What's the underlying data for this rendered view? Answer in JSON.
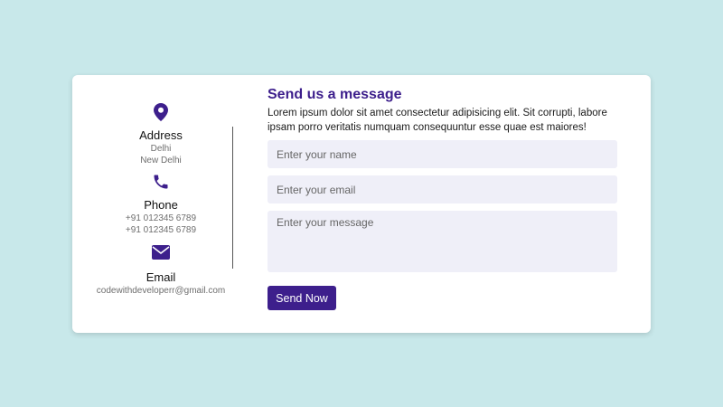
{
  "colors": {
    "background": "#c8e8ea",
    "accent": "#3d1f8c",
    "field_bg": "#efeff8"
  },
  "contact": {
    "address": {
      "icon": "map-pin-icon",
      "label": "Address",
      "lines": [
        "Delhi",
        "New Delhi"
      ]
    },
    "phone": {
      "icon": "phone-icon",
      "label": "Phone",
      "lines": [
        "+91 012345 6789",
        "+91 012345 6789"
      ]
    },
    "email": {
      "icon": "envelope-icon",
      "label": "Email",
      "lines": [
        "codewithdeveloperr@gmail.com"
      ]
    }
  },
  "form": {
    "title": "Send us a message",
    "description": "Lorem ipsum dolor sit amet consectetur adipisicing elit. Sit corrupti, labore ipsam porro veritatis numquam consequuntur esse quae est maiores!",
    "name_placeholder": "Enter your name",
    "email_placeholder": "Enter your email",
    "message_placeholder": "Enter your message",
    "submit_label": "Send Now"
  }
}
